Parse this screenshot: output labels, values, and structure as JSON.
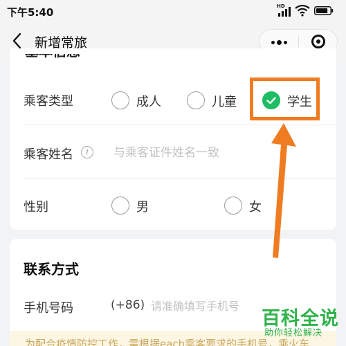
{
  "status_bar": {
    "time": "下午5:40",
    "network_badge": "HD",
    "battery_level": 0.85,
    "icons": [
      "signal-icon",
      "wifi-icon",
      "battery-icon"
    ]
  },
  "nav": {
    "back_icon": "chevron-left-icon",
    "title": "新增常旅",
    "more_icon": "more-dots-icon",
    "close_icon": "target-close-icon"
  },
  "basic_info": {
    "section_title": "基本信息",
    "passenger_type": {
      "label": "乘客类型",
      "options": [
        {
          "label": "成人",
          "selected": false
        },
        {
          "label": "儿童",
          "selected": false
        },
        {
          "label": "学生",
          "selected": true
        }
      ]
    },
    "passenger_name": {
      "label": "乘客姓名",
      "info_icon": "i",
      "value": "",
      "placeholder": "与乘客证件姓名一致"
    },
    "gender": {
      "label": "性别",
      "options": [
        {
          "label": "男",
          "selected": false
        },
        {
          "label": "女",
          "selected": false
        }
      ]
    }
  },
  "contact": {
    "section_title": "联系方式",
    "phone": {
      "label": "手机号码",
      "prefix": "(+86)",
      "value": "",
      "placeholder": "请准确填写手机号"
    }
  },
  "notice": {
    "text": "为配合疫情防控工作，需根据each乘客要求的手机号，乘火车"
  },
  "watermark": {
    "title": "百科全说",
    "subtitle": "助你轻松解决"
  },
  "colors": {
    "accent_green": "#1dbe63",
    "annotation_orange": "#f07c22",
    "watermark_green": "#2fb34a",
    "page_bg": "#f2f3f5"
  }
}
